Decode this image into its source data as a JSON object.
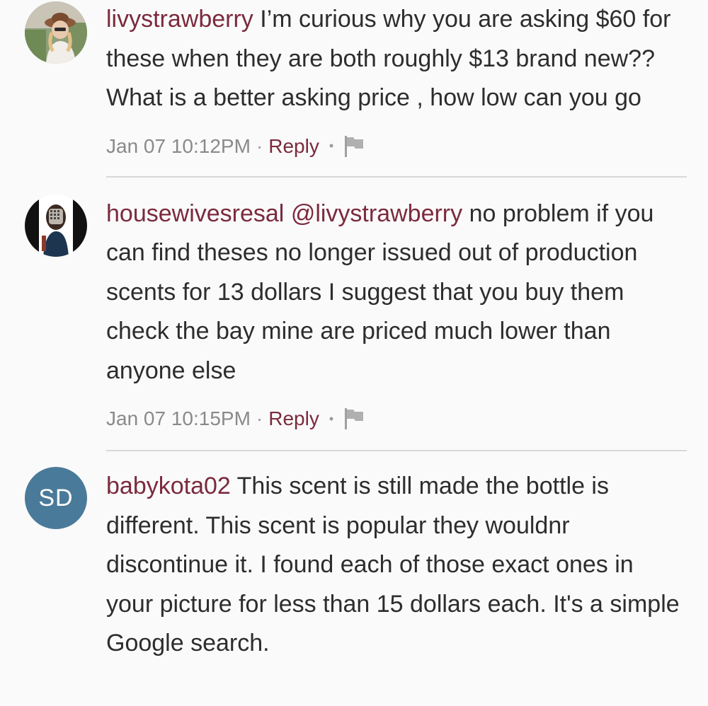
{
  "comments": [
    {
      "avatar_type": "photo",
      "username": "livystrawberry",
      "mention": "",
      "text": "I’m curious why you are asking $60 for these when they are both roughly $13 brand new?? What is a better asking price , how low can you go",
      "timestamp": "Jan 07 10:12PM",
      "reply_label": "Reply",
      "flag_icon": "flag-icon"
    },
    {
      "avatar_type": "photo",
      "username": "housewivesresal",
      "mention": "@livystrawberry",
      "text": "no problem if you can find theses no longer issued out of production scents for 13 dollars I suggest that you buy them check the bay mine are priced much lower than anyone else",
      "timestamp": "Jan 07 10:15PM",
      "reply_label": "Reply",
      "flag_icon": "flag-icon"
    },
    {
      "avatar_type": "initials",
      "avatar_initials": "SD",
      "avatar_color": "#4a7a99",
      "username": "babykota02",
      "mention": "",
      "text": "This scent is still made the bottle is different. This scent is popular they wouldnr discontinue it. I found each of those exact ones in your picture for less than 15 dollars each. It's a simple Google search."
    }
  ],
  "theme": {
    "accent": "#7b2a3e",
    "background": "#fafafa",
    "meta_text": "#8a8a8a"
  }
}
